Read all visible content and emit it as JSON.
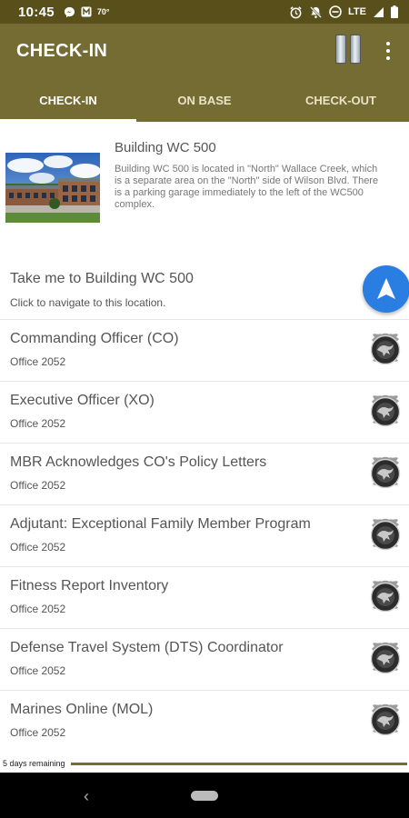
{
  "status_bar": {
    "time": "10:45",
    "temperature": "70°",
    "network": "LTE"
  },
  "app_bar": {
    "title": "CHECK-IN",
    "rank_icon": "captain-bars-icon",
    "menu_icon": "more-vert-icon"
  },
  "tabs": [
    {
      "label": "CHECK-IN",
      "active": true
    },
    {
      "label": "ON BASE",
      "active": false
    },
    {
      "label": "CHECK-OUT",
      "active": false
    }
  ],
  "building": {
    "title": "Building WC 500",
    "description": "Building WC 500 is located in \"North\" Wallace Creek, which is a separate area on the \"North\" side of Wilson Blvd.  There is a parking garage immediately to the left of the WC500 complex."
  },
  "navigate": {
    "title": "Take me to Building WC 500",
    "subtitle": "Click to navigate to this location.",
    "icon": "navigation-arrow-icon"
  },
  "items": [
    {
      "title": "Commanding Officer (CO)",
      "subtitle": "Office 2052"
    },
    {
      "title": "Executive Officer (XO)",
      "subtitle": "Office 2052"
    },
    {
      "title": "MBR Acknowledges CO's Policy Letters",
      "subtitle": "Office 2052"
    },
    {
      "title": "Adjutant: Exceptional Family Member Program",
      "subtitle": "Office 2052"
    },
    {
      "title": "Fitness Report Inventory",
      "subtitle": "Office 2052"
    },
    {
      "title": "Defense Travel System (DTS) Coordinator",
      "subtitle": "Office 2052"
    },
    {
      "title": "Marines Online (MOL)",
      "subtitle": "Office 2052"
    }
  ],
  "trial": {
    "label": "5 days remaining"
  },
  "colors": {
    "status_bar": "#584f1b",
    "app_bar": "#756c34",
    "fab": "#2a7de1"
  }
}
